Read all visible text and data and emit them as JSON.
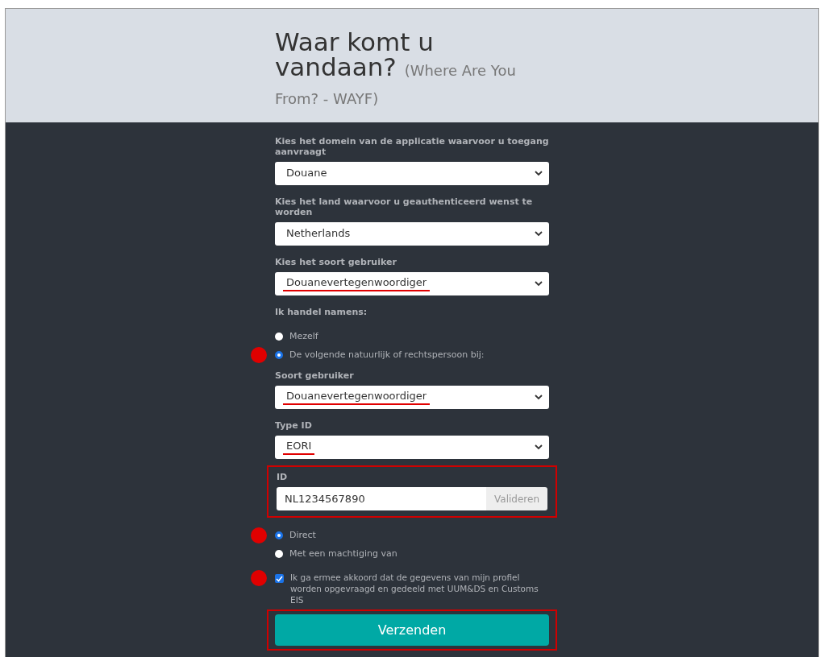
{
  "header": {
    "title": "Waar komt u vandaan?",
    "subtitle": "(Where Are You From? - WAYF)"
  },
  "form": [
    {
      "kind": "select",
      "label": "Kies het domein van de applicatie waarvoor u toegang aanvraagt",
      "value": "Douane",
      "underlined": false
    },
    {
      "kind": "select",
      "label": "Kies het land waarvoor u geauthenticeerd wenst te worden",
      "value": "Netherlands",
      "underlined": false
    },
    {
      "kind": "select",
      "label": "Kies het soort gebruiker",
      "value": "Douanevertegenwoordiger",
      "underlined": true
    },
    {
      "kind": "heading",
      "label": "Ik handel namens:"
    },
    {
      "kind": "radio",
      "label": "Mezelf",
      "selected": false,
      "marked": false
    },
    {
      "kind": "radio",
      "label": "De volgende natuurlijk of rechtspersoon bij:",
      "selected": true,
      "marked": true
    },
    {
      "kind": "select",
      "label": "Soort gebruiker",
      "value": "Douanevertegenwoordiger",
      "underlined": true
    },
    {
      "kind": "select",
      "label": "Type ID",
      "value": "EORI",
      "underlined": true
    },
    {
      "kind": "idfield",
      "label": "ID",
      "value": "NL1234567890",
      "button": "Valideren",
      "highlighted": true
    },
    {
      "kind": "radio",
      "label": "Direct",
      "selected": true,
      "marked": true
    },
    {
      "kind": "radio",
      "label": "Met een machtiging van",
      "selected": false,
      "marked": false
    },
    {
      "kind": "checkbox",
      "label": "Ik ga ermee akkoord dat de gegevens van mijn profiel worden opgevraagd en gedeeld met UUM&DS en Customs EIS",
      "checked": true,
      "marked": true
    },
    {
      "kind": "submit",
      "label": "Verzenden",
      "highlighted": true
    }
  ]
}
